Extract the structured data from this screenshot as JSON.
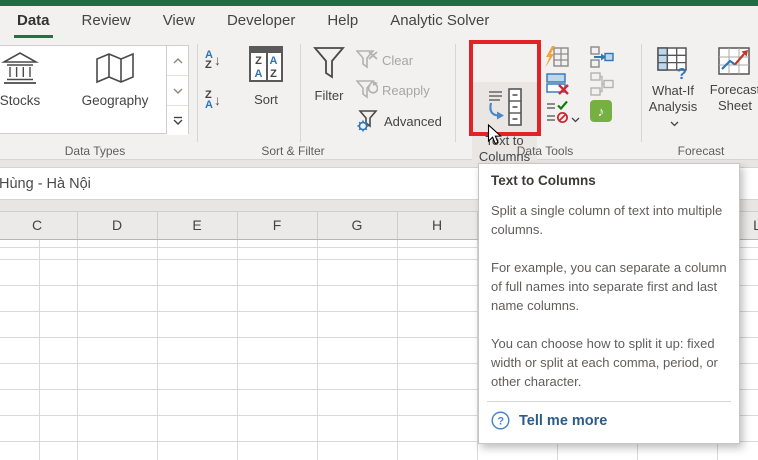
{
  "menu": {
    "tabs": [
      {
        "label": "Data",
        "active": true
      },
      {
        "label": "Review",
        "active": false
      },
      {
        "label": "View",
        "active": false
      },
      {
        "label": "Developer",
        "active": false
      },
      {
        "label": "Help",
        "active": false
      },
      {
        "label": "Analytic Solver",
        "active": false
      }
    ]
  },
  "ribbon": {
    "data_types": {
      "group_label": "Data Types",
      "stocks": "Stocks",
      "geography": "Geography"
    },
    "sort_filter": {
      "group_label": "Sort & Filter",
      "sort": "Sort",
      "filter": "Filter",
      "clear": "Clear",
      "reapply": "Reapply",
      "advanced": "Advanced"
    },
    "data_tools": {
      "group_label": "Data Tools",
      "text_to_columns_line1": "Text to",
      "text_to_columns_line2": "Columns"
    },
    "forecast": {
      "group_label": "Forecast",
      "what_if_line1": "What-If",
      "what_if_line2": "Analysis",
      "forecast_sheet_line1": "Forecast",
      "forecast_sheet_line2": "Sheet"
    }
  },
  "icon_glyphs": {
    "a": "A",
    "z": "Z",
    "question": "?",
    "note": "♪"
  },
  "formula_bar": {
    "value": "Hùng - Hà Nội"
  },
  "sheet": {
    "columns_left": [
      "C",
      "D",
      "E",
      "F",
      "G",
      "H"
    ],
    "column_right": "L"
  },
  "tooltip": {
    "title": "Text to Columns",
    "paragraphs": [
      "Split a single column of text into multiple columns.",
      "For example, you can separate a column of full names into separate first and last name columns.",
      "You can choose how to split it up: fixed width or split at each comma, period, or other character."
    ],
    "link": "Tell me more"
  },
  "colors": {
    "excel_green": "#217346",
    "highlight_red": "#e32227",
    "link_blue": "#2b5c8c",
    "icon_blue": "#2e75b6"
  }
}
